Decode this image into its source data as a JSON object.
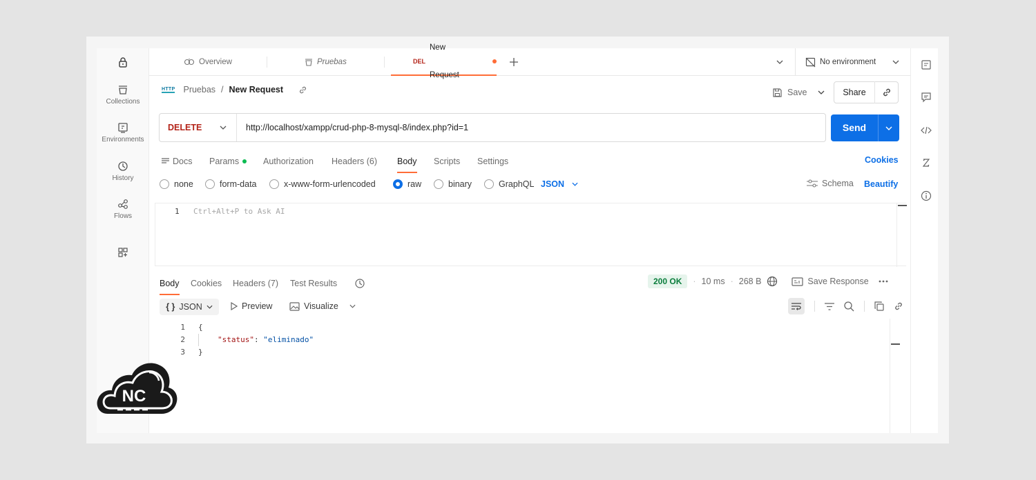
{
  "sidebar": {
    "items": [
      {
        "label": "Collections",
        "icon": "collections-icon"
      },
      {
        "label": "Environments",
        "icon": "environments-icon"
      },
      {
        "label": "History",
        "icon": "history-icon"
      },
      {
        "label": "Flows",
        "icon": "flows-icon"
      }
    ]
  },
  "tabs": {
    "overview": "Overview",
    "pruebas": "Pruebas",
    "active_method": "DEL",
    "active_label": "New Request",
    "environment": "No environment"
  },
  "breadcrumb": {
    "badge": "HTTP",
    "collection": "Pruebas",
    "separator": "/",
    "request": "New Request"
  },
  "actions": {
    "save": "Save",
    "share": "Share"
  },
  "request": {
    "method": "DELETE",
    "url": "http://localhost/xampp/crud-php-8-mysql-8/index.php?id=1",
    "send": "Send"
  },
  "request_tabs": [
    "Docs",
    "Params",
    "Authorization",
    "Headers (6)",
    "Body",
    "Scripts",
    "Settings"
  ],
  "cookies": "Cookies",
  "body_types": [
    "none",
    "form-data",
    "x-www-form-urlencoded",
    "raw",
    "binary",
    "GraphQL"
  ],
  "body_format": "JSON",
  "schema": "Schema",
  "beautify": "Beautify",
  "editor": {
    "line": "1",
    "placeholder": "Ctrl+Alt+P to Ask AI"
  },
  "response": {
    "tabs": [
      "Body",
      "Cookies",
      "Headers (7)",
      "Test Results"
    ],
    "status": "200 OK",
    "time": "10 ms",
    "size": "268 B",
    "save_response": "Save Response",
    "format": "JSON",
    "preview": "Preview",
    "visualize": "Visualize",
    "lines": [
      {
        "n": "1",
        "text": "{"
      },
      {
        "n": "2",
        "key": "\"status\"",
        "sep": ": ",
        "value": "\"eliminado\""
      },
      {
        "n": "3",
        "text": "}"
      }
    ]
  },
  "watermark": {
    "text": "NC"
  },
  "colors": {
    "accent": "#ff6c37",
    "send": "#0d6fe6",
    "delete": "#b42318",
    "ok": "#0a7d3c"
  }
}
